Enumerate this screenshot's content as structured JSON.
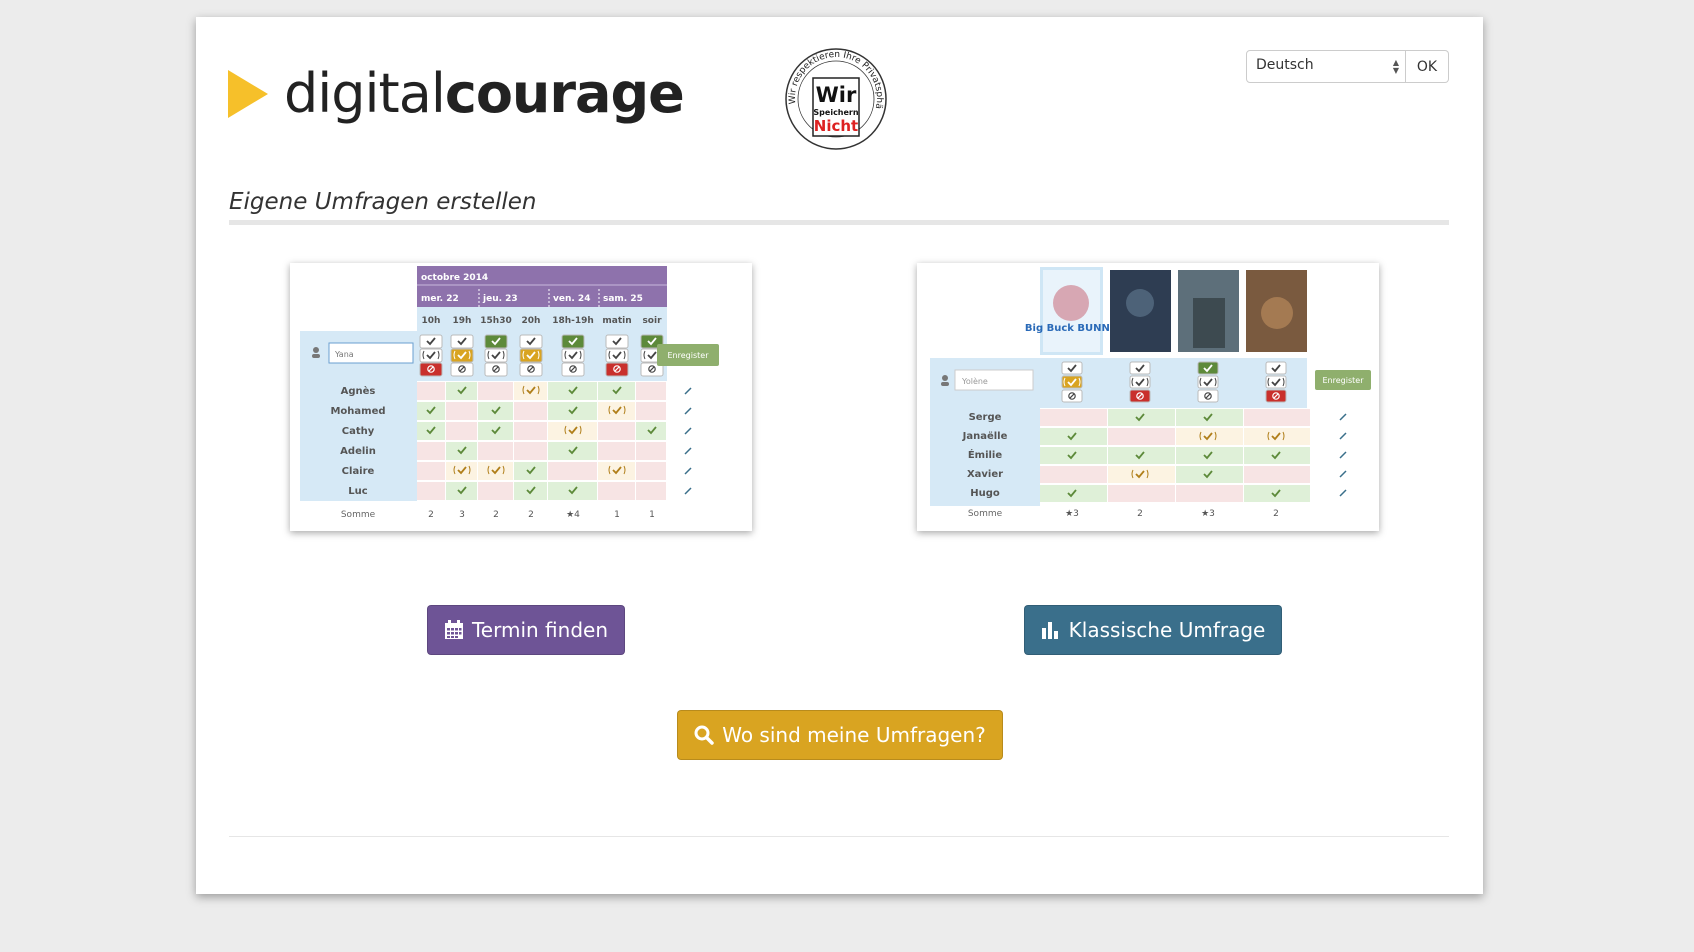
{
  "logo": {
    "text_light": "digital",
    "text_bold": "courage"
  },
  "seal": {
    "ring_text": "Wir respektieren Ihre Privatsphäre",
    "line1": "Wir",
    "line2": "Speichern",
    "line3": "Nicht"
  },
  "language": {
    "selected": "Deutsch",
    "ok_label": "OK"
  },
  "page_heading": "Eigene Umfragen erstellen",
  "date_poll_preview": {
    "month": "octobre 2014",
    "days": [
      "mer. 22",
      "jeu. 23",
      "ven. 24",
      "sam. 25"
    ],
    "times": [
      "10h",
      "19h",
      "15h30",
      "20h",
      "18h-19h",
      "matin",
      "soir"
    ],
    "input_value": "Yana",
    "save_label": "Enregister",
    "participants": [
      "Agnès",
      "Mohamed",
      "Cathy",
      "Adelin",
      "Claire",
      "Luc"
    ],
    "sum_label": "Somme",
    "sums": [
      "2",
      "3",
      "2",
      "2",
      "★4",
      "1",
      "1"
    ]
  },
  "classic_poll_preview": {
    "input_value": "Yolène",
    "save_label": "Enregister",
    "poster_texts": [
      "Big Buck BUNNY",
      "",
      "",
      ""
    ],
    "participants": [
      "Serge",
      "Janaëlle",
      "Émilie",
      "Xavier",
      "Hugo"
    ],
    "sum_label": "Somme",
    "sums": [
      "★3",
      "2",
      "★3",
      "2"
    ]
  },
  "buttons": {
    "termin_label": "Termin finden",
    "classic_label": "Klassische Umfrage",
    "where_label": "Wo sind meine Umfragen?"
  },
  "icons": [
    "calendar-icon",
    "bar-chart-icon",
    "search-icon",
    "user-icon",
    "pencil-icon"
  ],
  "colors": {
    "purple": "#6e5496",
    "teal": "#3a6f8b",
    "gold": "#d9a421",
    "logo_yellow": "#f6c02a",
    "yes_green": "#5d8a3a",
    "ifneed_orange": "#d9a421",
    "no_red": "#c9302c",
    "poll_header_purple": "#8e72ac",
    "poll_light_blue": "#d6e9f6"
  }
}
